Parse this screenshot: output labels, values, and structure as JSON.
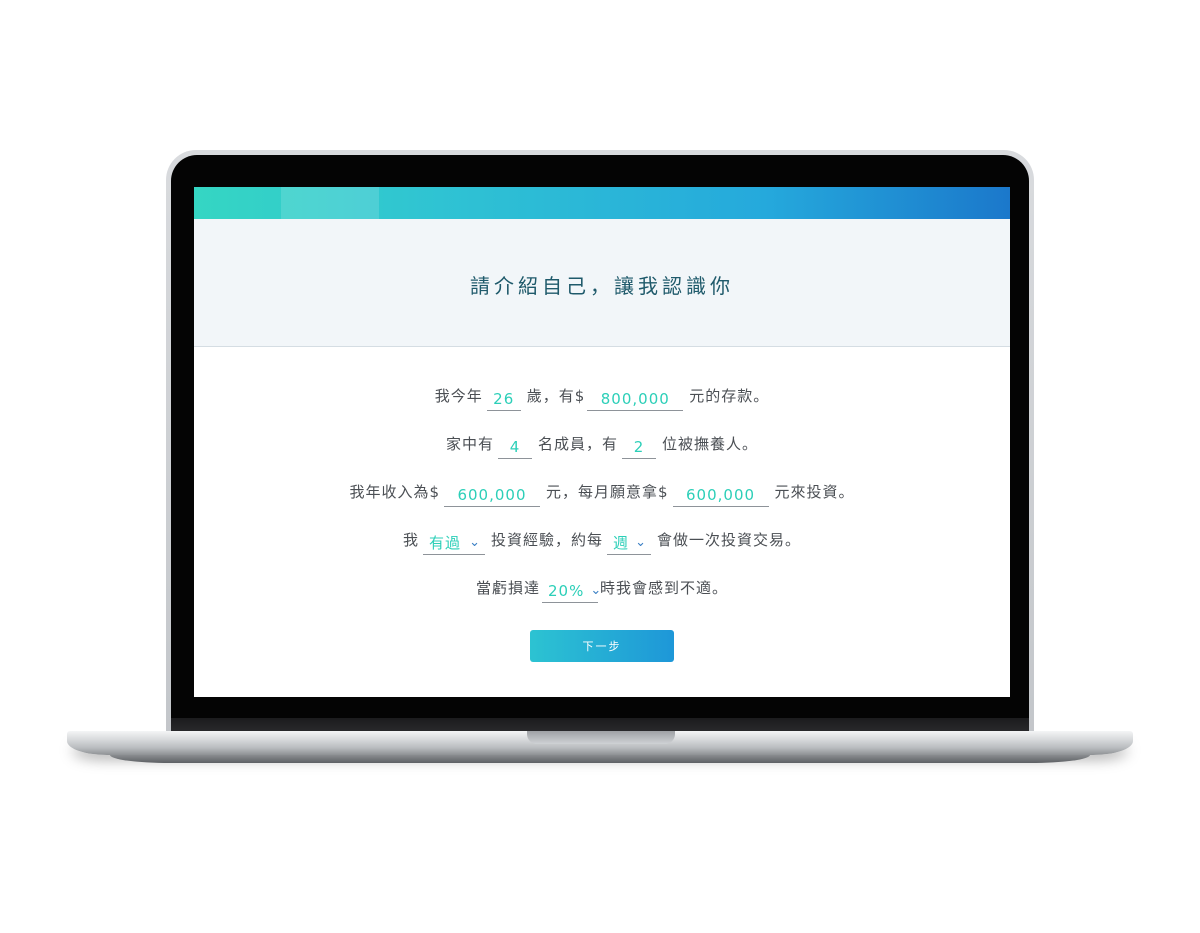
{
  "page": {
    "title": "請介紹自己，讓我認識你"
  },
  "form": {
    "row1": {
      "prefix": "我今年",
      "age": "26",
      "mid": "歲，有$",
      "savings": "800,000",
      "suffix": "元的存款。"
    },
    "row2": {
      "prefix": "家中有",
      "members": "4",
      "mid": "名成員，有",
      "dependents": "2",
      "suffix": "位被撫養人。"
    },
    "row3": {
      "prefix": "我年收入為$",
      "income": "600,000",
      "mid": "元，每月願意拿$",
      "invest": "600,000",
      "suffix": "元來投資。"
    },
    "row4": {
      "prefix": "我",
      "experience": "有過",
      "mid": "投資經驗，約每",
      "frequency": "週",
      "suffix": "會做一次投資交易。"
    },
    "row5": {
      "prefix": "當虧損達",
      "loss": "20%",
      "suffix": "時我會感到不適。"
    }
  },
  "actions": {
    "next_label": "下一步"
  },
  "icons": {
    "select_chevron": "chevron-down-icon"
  },
  "colors": {
    "accent_teal": "#2ccfb8",
    "title_color": "#1f5a6b",
    "gradient_start": "#35d6c3",
    "gradient_end": "#1b78cb"
  }
}
